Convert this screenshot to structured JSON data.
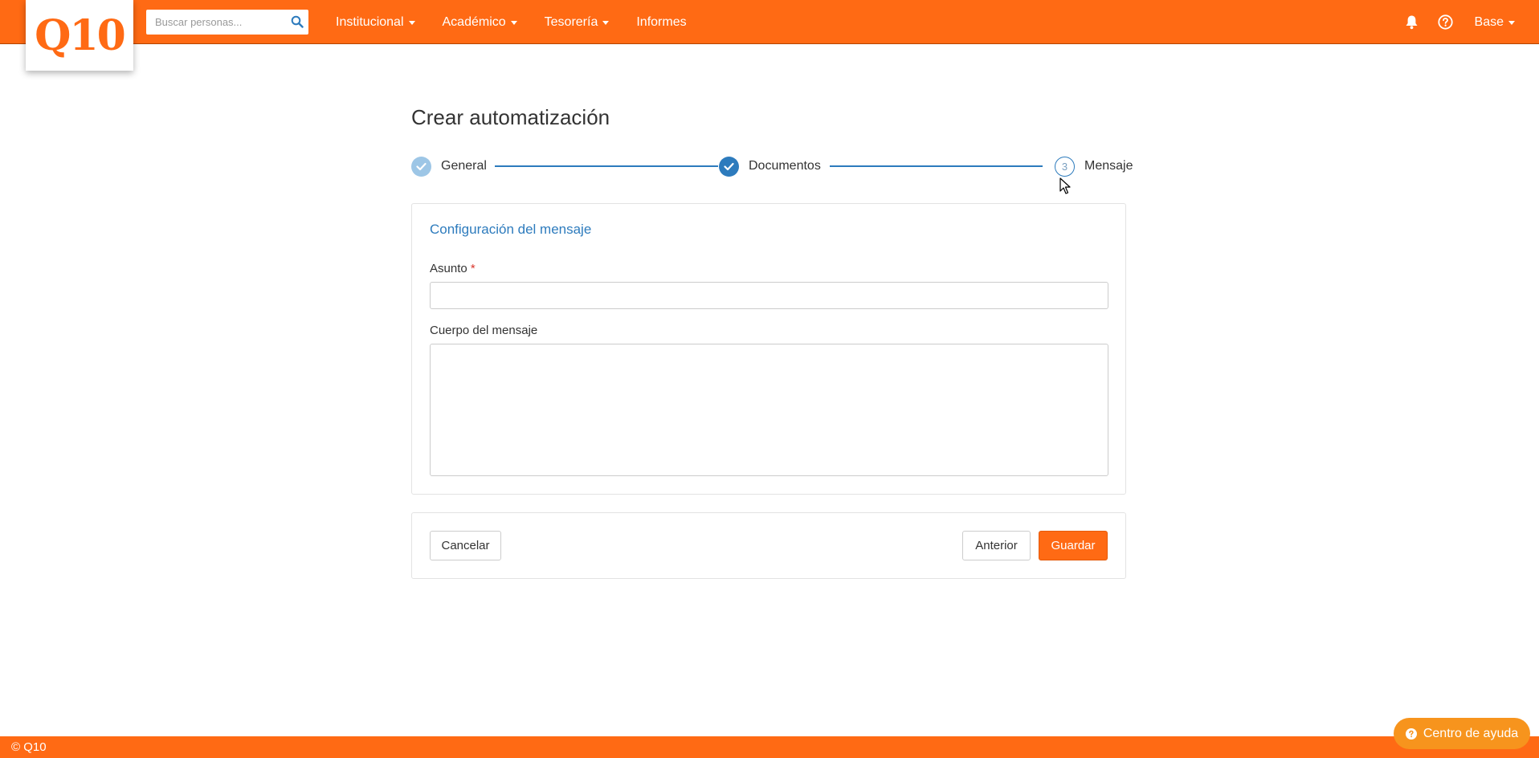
{
  "topbar": {
    "logo_text": "Q10",
    "search_placeholder": "Buscar personas...",
    "nav": [
      {
        "label": "Institucional",
        "dropdown": true
      },
      {
        "label": "Académico",
        "dropdown": true
      },
      {
        "label": "Tesorería",
        "dropdown": true
      },
      {
        "label": "Informes",
        "dropdown": false
      }
    ],
    "icons": [
      "bell-icon",
      "question-circle-icon"
    ],
    "user_label": "Base",
    "brand_color": "#ff6a14"
  },
  "page": {
    "title": "Crear automatización"
  },
  "stepper": {
    "steps": [
      {
        "label": "General",
        "state": "completed-light"
      },
      {
        "label": "Documentos",
        "state": "completed"
      },
      {
        "label": "Mensaje",
        "state": "current",
        "number": "3"
      }
    ],
    "active_color": "#2d7bbd",
    "completed_light_color": "#9dc6e6"
  },
  "form": {
    "section_title": "Configuración del mensaje",
    "subject_label": "Asunto",
    "required_mark": "*",
    "subject_value": "",
    "body_label": "Cuerpo del mensaje",
    "body_value": ""
  },
  "actions": {
    "cancel_label": "Cancelar",
    "previous_label": "Anterior",
    "save_label": "Guardar"
  },
  "footer": {
    "copyright": "© Q10",
    "help_center_label": "Centro de ayuda"
  }
}
